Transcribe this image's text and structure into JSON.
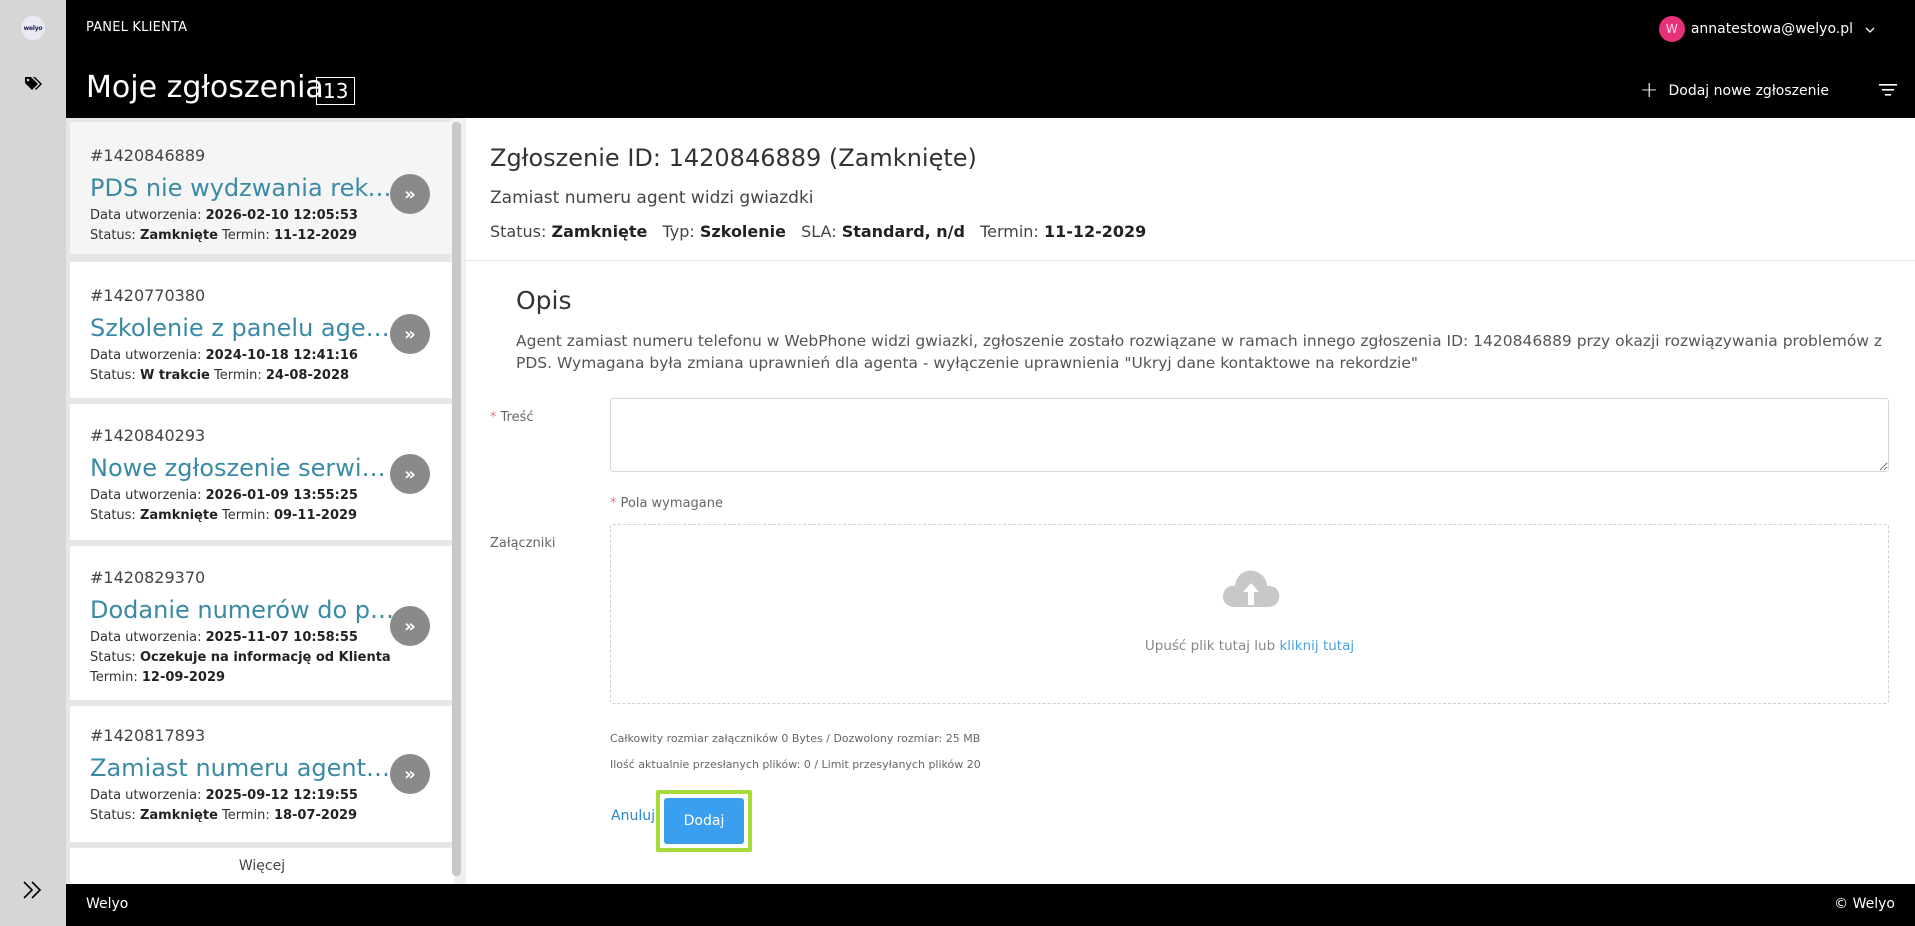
{
  "rail": {
    "logo_text": "welyo"
  },
  "header": {
    "panel_label": "PANEL KLIENTA",
    "page_title": "Moje zgłoszenia",
    "ticket_count": "13",
    "user_initial": "W",
    "user_email": "annatestowa@welyo.pl",
    "add_label": "Dodaj nowe zgłoszenie"
  },
  "list": {
    "labels": {
      "created": "Data utworzenia:",
      "status": "Status:",
      "deadline": "Termin:"
    },
    "items": [
      {
        "id": "#1420846889",
        "title": "PDS nie wydzwania rekordów",
        "created": "2026-02-10 12:05:53",
        "status": "Zamknięte",
        "deadline": "11-12-2029"
      },
      {
        "id": "#1420770380",
        "title": "Szkolenie z panelu agenta",
        "created": "2024-10-18 12:41:16",
        "status": "W trakcie",
        "deadline": "24-08-2028"
      },
      {
        "id": "#1420840293",
        "title": "Nowe zgłoszenie serwisowe",
        "created": "2026-01-09 13:55:25",
        "status": "Zamknięte",
        "deadline": "09-11-2029"
      },
      {
        "id": "#1420829370",
        "title": "Dodanie numerów do planu",
        "created": "2025-11-07 10:58:55",
        "status": "Oczekuje na informację od Klienta",
        "deadline": "12-09-2029"
      },
      {
        "id": "#1420817893",
        "title": "Zamiast numeru agent widzi gwiazdki",
        "created": "2025-09-12 12:19:55",
        "status": "Zamknięte",
        "deadline": "18-07-2029"
      }
    ],
    "more_label": "Więcej"
  },
  "detail": {
    "title": "Zgłoszenie ID: 1420846889 (Zamknięte)",
    "subtitle": "Zamiast numeru agent widzi gwiazdki",
    "meta": {
      "status_label": "Status:",
      "status": "Zamknięte",
      "type_label": "Typ:",
      "type": "Szkolenie",
      "sla_label": "SLA:",
      "sla": "Standard, n/d",
      "deadline_label": "Termin:",
      "deadline": "11-12-2029"
    },
    "opis_heading": "Opis",
    "opis_text": "Agent zamiast numeru telefonu w WebPhone widzi gwiazki, zgłoszenie zostało rozwiązane w ramach innego zgłoszenia ID: 1420846889 przy okazji rozwiązywania problemów z PDS. Wymagana była zmiana uprawnień dla agenta - wyłączenie uprawnienia \"Ukryj dane kontaktowe na rekordzie\"",
    "content_label": "Treść",
    "content_value": "",
    "required_note": "Pola wymagane",
    "attachments_label": "Załączniki",
    "drop_text": "Upuść plik tutaj lub",
    "drop_link": "kliknij tutaj",
    "size_info": "Całkowity rozmiar załączników 0 Bytes / Dozwolony rozmiar: 25 MB",
    "count_info": "Ilość aktualnie przesłanych plików: 0 / Limit przesyłanych plików 20",
    "cancel_label": "Anuluj",
    "submit_label": "Dodaj"
  },
  "footer": {
    "left": "Welyo",
    "right": "© Welyo"
  },
  "colors": {
    "accent": "#3b9ff0",
    "title_link": "#3a8aa5",
    "highlight": "#a6db38",
    "avatar": "#e8317a"
  }
}
